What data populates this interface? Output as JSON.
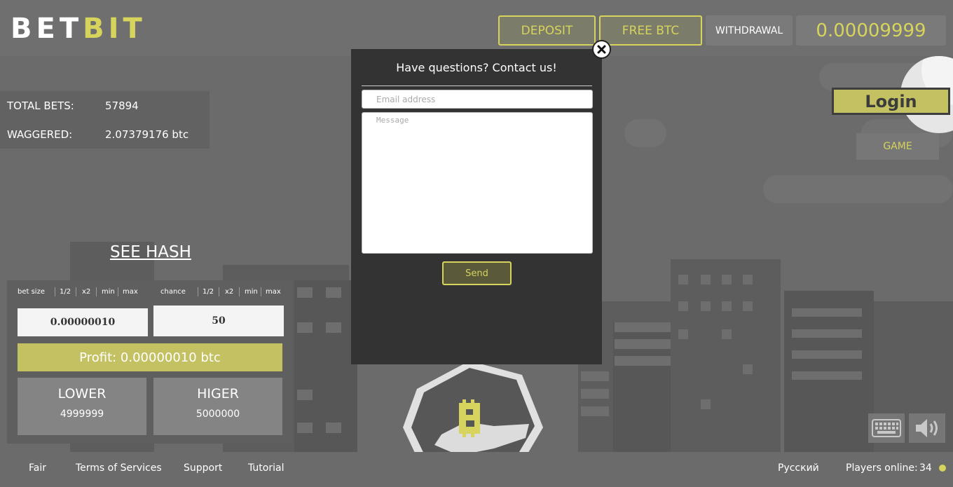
{
  "header": {
    "logo_part1": "BET",
    "logo_part2": "BIT",
    "deposit": "DEPOSIT",
    "free_btc": "FREE BTC",
    "withdrawal": "WITHDRAWAL",
    "balance": "0.00009999"
  },
  "stats": {
    "total_bets_label": "TOTAL BETS:",
    "total_bets_value": "57894",
    "wagered_label": "WAGGERED:",
    "wagered_value": "2.07379176 btc"
  },
  "see_hash": "SEE HASH",
  "bet": {
    "bet_size_label": "bet size",
    "chance_label": "chance",
    "half": "1/2",
    "double": "x2",
    "min": "min",
    "max": "max",
    "bet_size_value": "0.00000010",
    "chance_value": "50",
    "profit": "Profit: 0.00000010 btc",
    "lower_label": "LOWER",
    "lower_value": "4999999",
    "higher_label": "HIGER",
    "higher_value": "5000000"
  },
  "right": {
    "login": "Login",
    "game": "GAME"
  },
  "modal": {
    "title": "Have questions? Contact us!",
    "email_placeholder": "Email address",
    "message_placeholder": "Message",
    "send": "Send"
  },
  "footer": {
    "fair": "Fair",
    "terms": "Terms of Services",
    "support": "Support",
    "tutorial": "Tutorial",
    "language": "Русский",
    "players_online_label": "Players online:",
    "players_online_value": "34"
  },
  "colors": {
    "accent": "#d6d45c",
    "background": "#6b6b6b",
    "modal": "#333333"
  },
  "icons": [
    "close-icon",
    "keyboard-icon",
    "sound-icon",
    "bitcoin-icon"
  ]
}
